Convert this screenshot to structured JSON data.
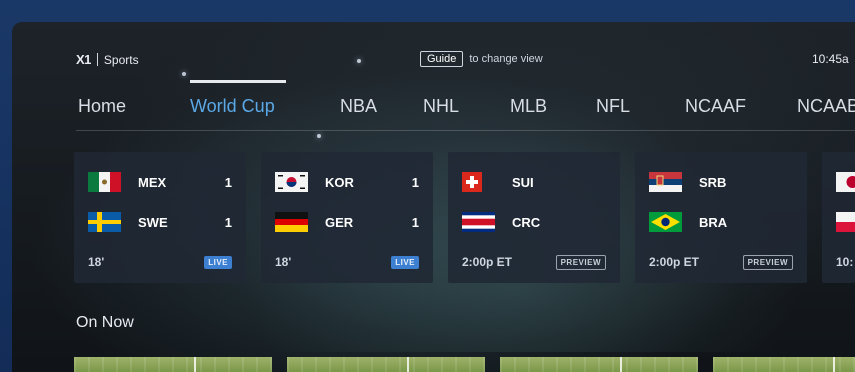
{
  "header": {
    "logo_mark": "X1",
    "logo_text": "Sports",
    "guide_key": "Guide",
    "guide_hint": "to change view",
    "clock": "10:45a"
  },
  "tabs": [
    {
      "label": "Home",
      "active": false
    },
    {
      "label": "World Cup",
      "active": true
    },
    {
      "label": "NBA",
      "active": false
    },
    {
      "label": "NHL",
      "active": false
    },
    {
      "label": "MLB",
      "active": false
    },
    {
      "label": "NFL",
      "active": false
    },
    {
      "label": "NCAAF",
      "active": false
    },
    {
      "label": "NCAAB",
      "active": false
    }
  ],
  "matches": [
    {
      "home": {
        "code": "MEX",
        "score": "1",
        "flag": "mexico-flag"
      },
      "away": {
        "code": "SWE",
        "score": "1",
        "flag": "sweden-flag"
      },
      "time": "18'",
      "badge": "LIVE"
    },
    {
      "home": {
        "code": "KOR",
        "score": "1",
        "flag": "south-korea-flag"
      },
      "away": {
        "code": "GER",
        "score": "1",
        "flag": "germany-flag"
      },
      "time": "18'",
      "badge": "LIVE"
    },
    {
      "home": {
        "code": "SUI",
        "score": "",
        "flag": "switzerland-flag"
      },
      "away": {
        "code": "CRC",
        "score": "",
        "flag": "costa-rica-flag"
      },
      "time": "2:00p ET",
      "badge": "PREVIEW"
    },
    {
      "home": {
        "code": "SRB",
        "score": "",
        "flag": "serbia-flag"
      },
      "away": {
        "code": "BRA",
        "score": "",
        "flag": "brazil-flag"
      },
      "time": "2:00p ET",
      "badge": "PREVIEW"
    },
    {
      "home": {
        "code": "",
        "score": "",
        "flag": "japan-flag"
      },
      "away": {
        "code": "",
        "score": "",
        "flag": "poland-flag"
      },
      "time": "10:",
      "badge": ""
    }
  ],
  "on_now": {
    "title": "On Now"
  },
  "colors": {
    "accent": "#5aa8e6",
    "live": "#3d7fd0",
    "background": "#1f3f73"
  }
}
